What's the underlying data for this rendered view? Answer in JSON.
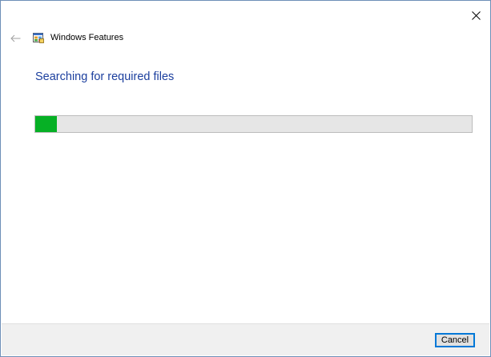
{
  "window": {
    "title": "Windows Features",
    "app_icon": "windows-features-icon",
    "close_icon": "close-icon",
    "back_icon": "back-arrow-icon"
  },
  "main": {
    "heading": "Searching for required files",
    "progress_fraction": 0.05
  },
  "footer": {
    "cancel_label": "Cancel"
  },
  "colors": {
    "heading": "#1c3f9e",
    "progress_fill": "#06b025",
    "progress_track": "#e6e6e6",
    "footer_bg": "#f0f0f0",
    "button_focus_border": "#0078d7"
  }
}
